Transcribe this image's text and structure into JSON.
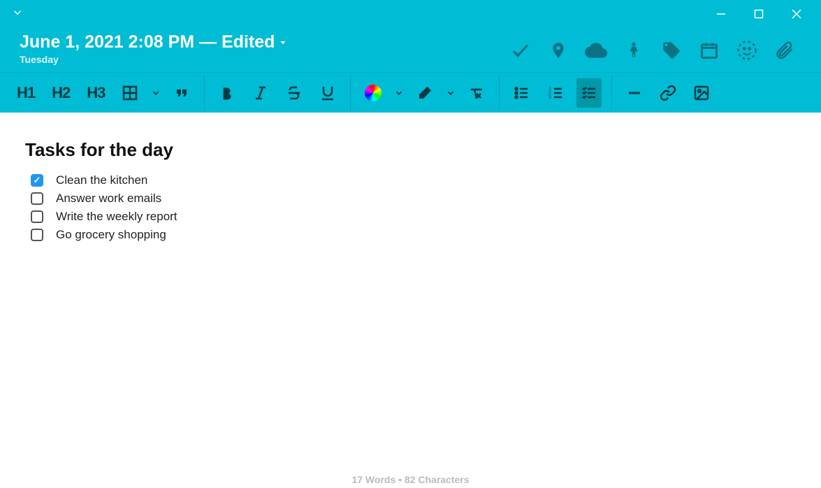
{
  "header": {
    "title": "June 1, 2021 2:08 PM — Edited",
    "subtitle": "Tuesday"
  },
  "content": {
    "heading": "Tasks for the day",
    "tasks": [
      {
        "label": "Clean the kitchen",
        "checked": true
      },
      {
        "label": "Answer work emails",
        "checked": false
      },
      {
        "label": "Write the weekly report",
        "checked": false
      },
      {
        "label": "Go grocery shopping",
        "checked": false
      }
    ]
  },
  "toolbar": {
    "h1": "H1",
    "h2": "H2",
    "h3": "H3"
  },
  "statusbar": {
    "text": "17 Words • 82 Characters"
  }
}
